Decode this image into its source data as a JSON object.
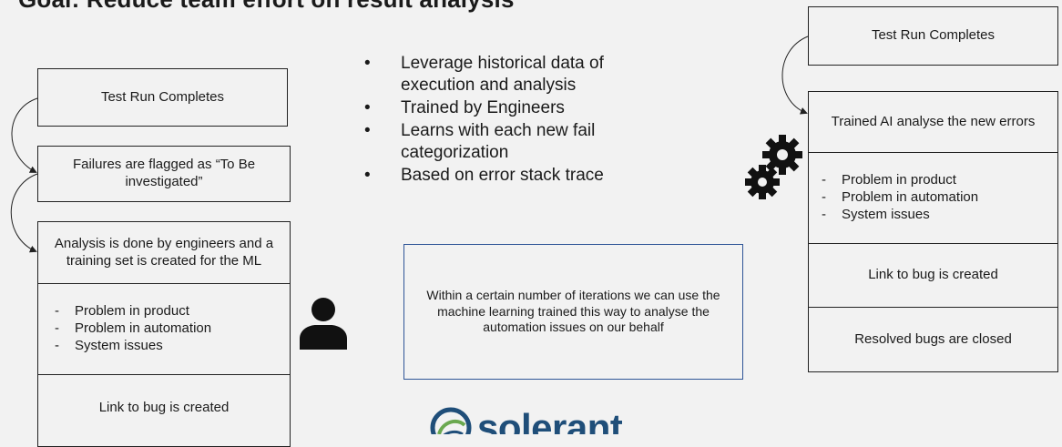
{
  "title": "Goal: Reduce team effort on result analysis",
  "left_flow": {
    "step1": "Test Run Completes",
    "step2": "Failures are flagged as “To Be investigated”",
    "step3": "Analysis is done by engineers and a training set is created for the ML",
    "categories": [
      "Problem in product",
      "Problem in automation",
      "System issues"
    ],
    "step5": "Link to bug is created"
  },
  "bullets": [
    "Leverage historical data of execution and analysis",
    "Trained by Engineers",
    "Learns with each new fail categorization",
    "Based on error stack trace"
  ],
  "note": "Within a certain number of iterations we can use the machine learning trained this way to analyse the automation issues on our behalf",
  "right_flow": {
    "step1": "Test Run Completes",
    "step2": "Trained AI analyse the new errors",
    "categories": [
      "Problem in product",
      "Problem in automation",
      "System issues"
    ],
    "step4": "Link to bug is created",
    "step5": "Resolved bugs are closed"
  },
  "logo": {
    "text": "solerant"
  },
  "icons": {
    "person": "person-icon",
    "gears": "gears-icon",
    "logo_mark": "logo-swirl-icon"
  },
  "colors": {
    "background": "#f2f2f2",
    "note_border": "#2f5597",
    "logo_blue": "#1f4e79",
    "logo_green": "#6aa84f"
  }
}
